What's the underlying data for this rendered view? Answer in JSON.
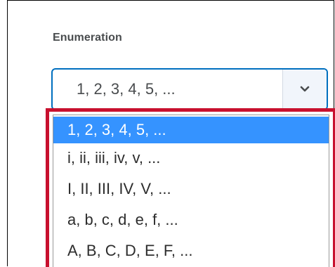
{
  "field": {
    "label": "Enumeration",
    "selected_value": "1, 2, 3, 4, 5, ...",
    "toggle_icon": "chevron-down-icon"
  },
  "dropdown": {
    "options": [
      {
        "label": "1, 2, 3, 4, 5, ...",
        "selected": true
      },
      {
        "label": "i, ii, iii, iv, v, ...",
        "selected": false
      },
      {
        "label": "I, II, III, IV, V, ...",
        "selected": false
      },
      {
        "label": "a, b, c, d, e, f, ...",
        "selected": false
      },
      {
        "label": "A, B, C, D, E, F, ...",
        "selected": false
      }
    ]
  },
  "colors": {
    "select_border": "#006fbf",
    "highlight_frame": "#c8102e",
    "selected_option_bg": "#3593ff",
    "text": "#494c4e"
  }
}
